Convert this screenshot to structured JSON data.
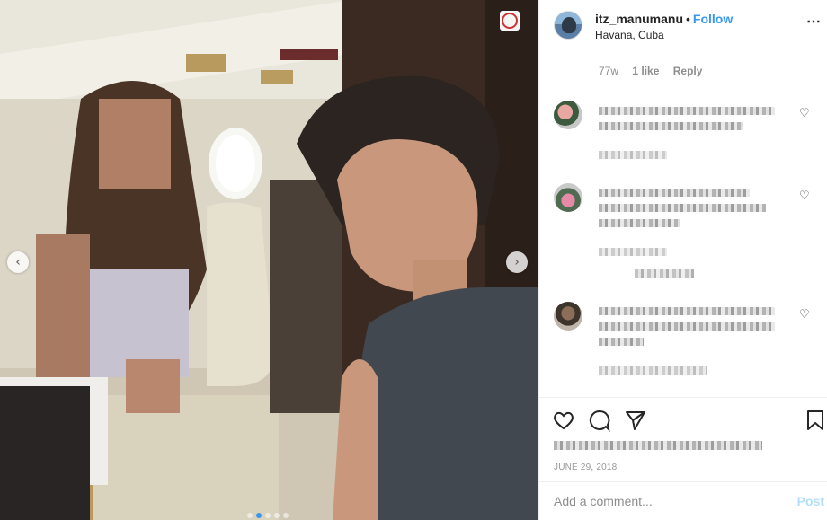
{
  "post": {
    "username": "itz_manumanu",
    "separator": "•",
    "follow_label": "Follow",
    "location": "Havana, Cuba",
    "more_icon": "⋯"
  },
  "caption_meta": {
    "age": "77w",
    "likes": "1 like",
    "reply_label": "Reply"
  },
  "photo": {
    "prev_icon": "‹",
    "next_icon": "›",
    "carousel_dots": 5,
    "active_dot": 1
  },
  "actions": {
    "like_icon": "heart-outline",
    "comment_icon": "comment-bubble",
    "share_icon": "paper-plane",
    "save_icon": "bookmark"
  },
  "date": "JUNE 29, 2018",
  "add_comment": {
    "placeholder": "Add a comment...",
    "post_label": "Post"
  },
  "colors": {
    "accent": "#3897f0",
    "post_disabled": "#b2dffc",
    "muted": "#8e8e8e"
  }
}
